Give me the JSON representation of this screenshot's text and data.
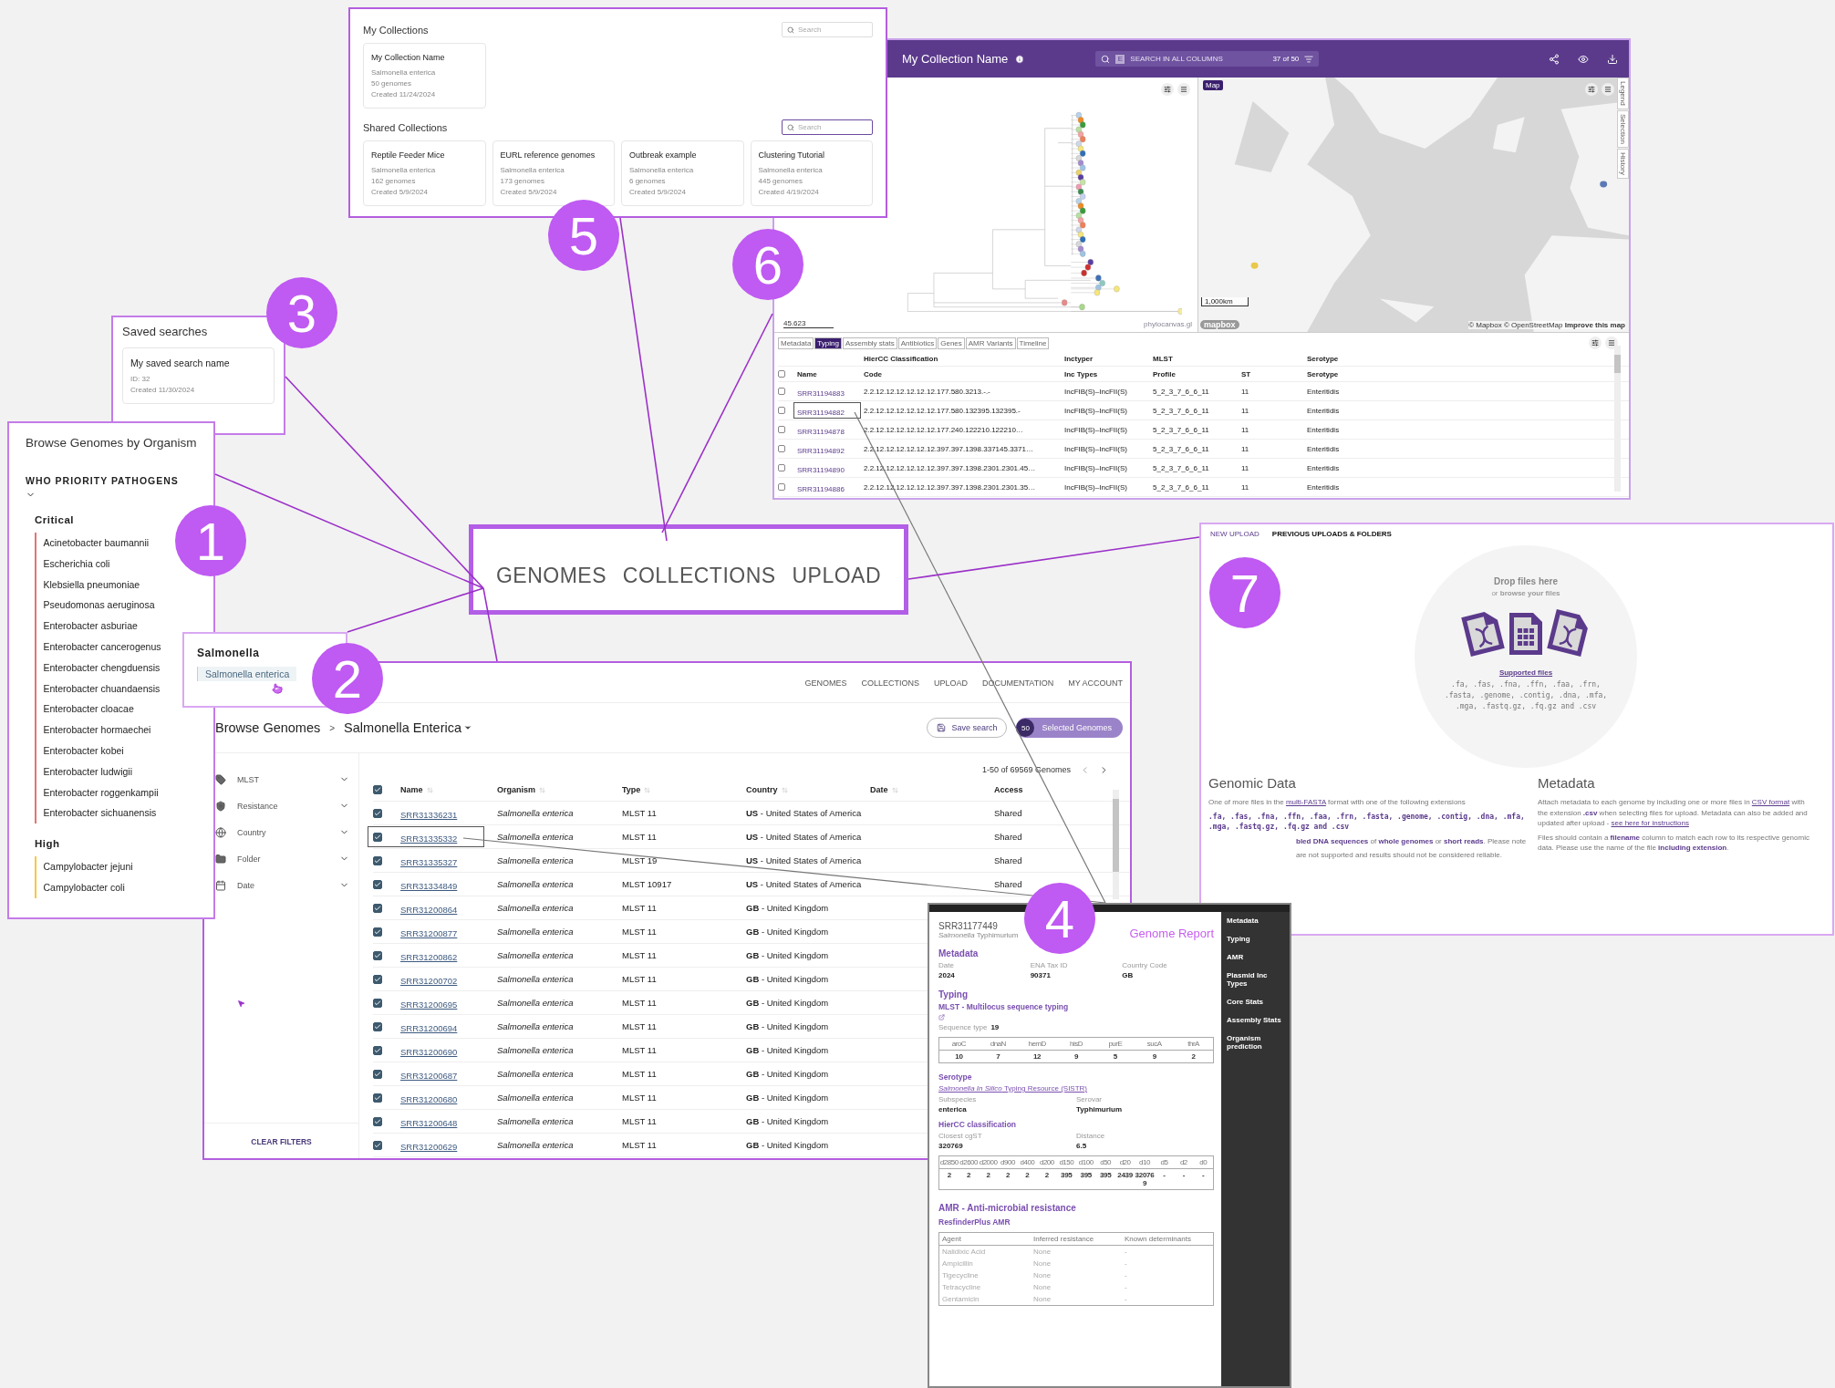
{
  "callouts": [
    "1",
    "2",
    "3",
    "4",
    "5",
    "6",
    "7"
  ],
  "saved_searches": {
    "title": "Saved searches",
    "items": [
      {
        "name": "My saved search name",
        "id": "ID: 32",
        "created": "Created 11/30/2024"
      }
    ]
  },
  "organism_browser": {
    "title": "Browse Genomes by Organism",
    "group": "WHO PRIORITY PATHOGENS",
    "expanded": true,
    "sections": [
      {
        "title": "Critical",
        "color": "#e57373",
        "items": [
          "Acinetobacter baumannii",
          "Escherichia coli",
          "Klebsiella pneumoniae",
          "Pseudomonas aeruginosa",
          "Enterobacter asburiae",
          "Enterobacter cancerogenus",
          "Enterobacter chengduensis",
          "Enterobacter chuandaensis",
          "Enterobacter cloacae",
          "Enterobacter hormaechei",
          "Enterobacter kobei",
          "Enterobacter ludwigii",
          "Enterobacter roggenkampii",
          "Enterobacter sichuanensis"
        ]
      },
      {
        "title": "High",
        "color": "#f5c842",
        "items": [
          "Campylobacter jejuni",
          "Campylobacter coli"
        ]
      }
    ]
  },
  "organism_popup": {
    "genus": "Salmonella",
    "species": "Salmonella enterica"
  },
  "nav_zoom": {
    "items": [
      "GENOMES",
      "COLLECTIONS",
      "UPLOAD"
    ]
  },
  "browse": {
    "nav": [
      "GENOMES",
      "COLLECTIONS",
      "UPLOAD",
      "DOCUMENTATION",
      "MY ACCOUNT"
    ],
    "breadcrumb": "Browse Genomes",
    "all_selected": true,
    "breadcrumb_separator": ">",
    "organism": "Salmonella Enterica",
    "save_button": "Save search",
    "selected_count": "50",
    "selected_label": "Selected Genomes",
    "filters": [
      "MLST",
      "Resistance",
      "Country",
      "Folder",
      "Date"
    ],
    "clear_filters": "CLEAR FILTERS",
    "pagination": "1-50 of 69569 Genomes",
    "columns": [
      {
        "label": "Name",
        "sortable": true
      },
      {
        "label": "Organism",
        "sortable": true
      },
      {
        "label": "Type",
        "sortable": true
      },
      {
        "label": "Country",
        "sortable": true
      },
      {
        "label": "Date",
        "sortable": true
      },
      {
        "label": "Access",
        "sortable": false
      }
    ],
    "rows": [
      {
        "checked": true,
        "highlighted": false,
        "name": "SRR31336231",
        "organism": "Salmonella enterica",
        "type": "MLST 11",
        "country": "**US** - United States of America",
        "access": "Shared"
      },
      {
        "checked": true,
        "highlighted": true,
        "name": "SRR31335332",
        "organism": "Salmonella enterica",
        "type": "MLST 11",
        "country": "**US** - United States of America",
        "access": "Shared"
      },
      {
        "checked": true,
        "highlighted": false,
        "name": "SRR31335327",
        "organism": "Salmonella enterica",
        "type": "MLST 19",
        "country": "**US** - United States of America",
        "access": "Shared"
      },
      {
        "checked": true,
        "highlighted": false,
        "name": "SRR31334849",
        "organism": "Salmonella enterica",
        "type": "MLST 10917",
        "country": "**US** - United States of America",
        "access": "Shared"
      },
      {
        "checked": true,
        "highlighted": false,
        "name": "SRR31200864",
        "organism": "Salmonella enterica",
        "type": "MLST 11",
        "country": "**GB** - United Kingdom"
      },
      {
        "checked": true,
        "highlighted": false,
        "name": "SRR31200877",
        "organism": "Salmonella enterica",
        "type": "MLST 11",
        "country": "**GB** - United Kingdom"
      },
      {
        "checked": true,
        "highlighted": false,
        "name": "SRR31200862",
        "organism": "Salmonella enterica",
        "type": "MLST 11",
        "country": "**GB** - United Kingdom"
      },
      {
        "checked": true,
        "highlighted": false,
        "name": "SRR31200702",
        "organism": "Salmonella enterica",
        "type": "MLST 11",
        "country": "**GB** - United Kingdom"
      },
      {
        "checked": true,
        "highlighted": false,
        "name": "SRR31200695",
        "organism": "Salmonella enterica",
        "type": "MLST 11",
        "country": "**GB** - United Kingdom"
      },
      {
        "checked": true,
        "highlighted": false,
        "name": "SRR31200694",
        "organism": "Salmonella enterica",
        "type": "MLST 11",
        "country": "**GB** - United Kingdom"
      },
      {
        "checked": true,
        "highlighted": false,
        "name": "SRR31200690",
        "organism": "Salmonella enterica",
        "type": "MLST 11",
        "country": "**GB** - United Kingdom"
      },
      {
        "checked": true,
        "highlighted": false,
        "name": "SRR31200687",
        "organism": "Salmonella enterica",
        "type": "MLST 11",
        "country": "**GB** - United Kingdom"
      },
      {
        "checked": true,
        "highlighted": false,
        "name": "SRR31200680",
        "organism": "Salmonella enterica",
        "type": "MLST 11",
        "country": "**GB** - United Kingdom"
      },
      {
        "checked": true,
        "highlighted": false,
        "name": "SRR31200648",
        "organism": "Salmonella enterica",
        "type": "MLST 11",
        "country": "**GB** - United Kingdom"
      },
      {
        "checked": true,
        "highlighted": false,
        "name": "SRR31200629",
        "organism": "Salmonella enterica",
        "type": "MLST 11",
        "country": "**GB** - United Kingdom"
      }
    ]
  },
  "collections": {
    "groups": [
      {
        "title": "My Collections",
        "search_placeholder": "Search",
        "focused": false,
        "cards": [
          {
            "name": "My Collection Name",
            "organism": "Salmonella enterica",
            "count": "50 genomes",
            "created": "Created 11/24/2024"
          }
        ]
      },
      {
        "title": "Shared Collections",
        "search_placeholder": "Search",
        "focused": true,
        "cards": [
          {
            "name": "Reptile Feeder Mice",
            "organism": "Salmonella enterica",
            "count": "162 genomes",
            "created": "Created 5/9/2024"
          },
          {
            "name": "EURL reference genomes",
            "organism": "Salmonella enterica",
            "count": "173 genomes",
            "created": "Created 5/9/2024"
          },
          {
            "name": "Outbreak example",
            "organism": "Salmonella enterica",
            "count": "6 genomes",
            "created": "Created 5/9/2024"
          },
          {
            "name": "Clustering Tutorial",
            "organism": "Salmonella enterica",
            "count": "445 genomes",
            "created": "Created 4/19/2024"
          }
        ]
      }
    ]
  },
  "viewer": {
    "title": "My Collection Name",
    "search_key": "E",
    "search_placeholder": "SEARCH IN ALL COLUMNS",
    "search_count": "37 of 50",
    "all_selected": false,
    "tree_scale": "45.623",
    "tree_brand": "phylocanvas.gl",
    "map_badge": "Map",
    "map_scale": "1,000km",
    "map_logo": "mapbox",
    "map_attribution": "© Mapbox © OpenStreetMap **Improve this map**",
    "side_tabs": [
      "Legend",
      "Selection",
      "History"
    ],
    "tabs": [
      {
        "label": "Metadata",
        "selected": false
      },
      {
        "label": "Typing",
        "selected": true
      },
      {
        "label": "Assembly stats",
        "selected": false
      },
      {
        "label": "Antibiotics",
        "selected": false
      },
      {
        "label": "Genes",
        "selected": false
      },
      {
        "label": "AMR Variants",
        "selected": false
      },
      {
        "label": "Timeline",
        "selected": false
      }
    ],
    "columns": [
      {
        "label": "Name"
      },
      {
        "label": "Code",
        "group": "HierCC Classification"
      },
      {
        "label": "Inc Types",
        "group": "Inctyper"
      },
      {
        "label": "Profile",
        "group": "MLST"
      },
      {
        "label": "ST"
      },
      {
        "label": "Serotype",
        "group": "Serotype"
      }
    ],
    "rows": [
      {
        "checked": false,
        "highlighted": false,
        "name": "SRR31194883",
        "code": "2.2.12.12.12.12.12.12.177.580.3213.-.-",
        "inc": "IncFIB(S)–IncFII(S)",
        "profile": "5_2_3_7_6_6_11",
        "st": "11",
        "serotype": "Enteritidis"
      },
      {
        "checked": false,
        "highlighted": true,
        "name": "SRR31194882",
        "code": "2.2.12.12.12.12.12.12.177.580.132395.132395.-",
        "inc": "IncFIB(S)–IncFII(S)",
        "profile": "5_2_3_7_6_6_11",
        "st": "11",
        "serotype": "Enteritidis"
      },
      {
        "checked": false,
        "highlighted": false,
        "name": "SRR31194878",
        "code": "2.2.12.12.12.12.12.12.177.240.122210.122210…",
        "inc": "IncFIB(S)–IncFII(S)",
        "profile": "5_2_3_7_6_6_11",
        "st": "11",
        "serotype": "Enteritidis"
      },
      {
        "checked": false,
        "highlighted": false,
        "name": "SRR31194892",
        "code": "2.2.12.12.12.12.12.12.397.397.1398.337145.3371…",
        "inc": "IncFIB(S)–IncFII(S)",
        "profile": "5_2_3_7_6_6_11",
        "st": "11",
        "serotype": "Enteritidis"
      },
      {
        "checked": false,
        "highlighted": false,
        "name": "SRR31194890",
        "code": "2.2.12.12.12.12.12.12.397.397.1398.2301.2301.45…",
        "inc": "IncFIB(S)–IncFII(S)",
        "profile": "5_2_3_7_6_6_11",
        "st": "11",
        "serotype": "Enteritidis"
      },
      {
        "checked": false,
        "highlighted": false,
        "name": "SRR31194886",
        "code": "2.2.12.12.12.12.12.12.397.397.1398.2301.2301.35…",
        "inc": "IncFIB(S)–IncFII(S)",
        "profile": "5_2_3_7_6_6_11",
        "st": "11",
        "serotype": "Enteritidis"
      }
    ]
  },
  "upload": {
    "tabs": [
      {
        "label": "NEW UPLOAD",
        "selected": true
      },
      {
        "label": "PREVIOUS UPLOADS & FOLDERS",
        "selected": false
      }
    ],
    "drop_title": "Drop files here",
    "drop_hint": "or **browse your files**",
    "supported_link": "Supported files",
    "supported_list": ".fa, .fas, .fna, .ffn, .faa, .frn, .fasta, .genome, .contig, .dna, .mfa, .mga, .fastq.gz, .fq.gz and .csv",
    "genomic": {
      "title": "Genomic Data",
      "intro_before": "One of more files in the",
      "intro_link": "multi-FASTA",
      "intro_after": "format with one of the following extensions",
      "extensions": ".fa, .fas, .fna, .ffn, .faa, .frn, .fasta, .genome, .contig, .dna, .mfa, .mga, .fastq.gz, .fq.gz and .csv",
      "note_lines": [
        "**bled DNA sequences** of **whole genomes** or **short reads**. Please note",
        "are not supported and results should not be considered reliable."
      ]
    },
    "metadata": {
      "title": "Metadata",
      "text_before": "Attach metadata to each genome by including one or more files in",
      "link": "CSV format",
      "text_after": "with the extension **.csv** when selecting files for upload. Metadata can also be added and updated after upload -",
      "link2": "see here for instructions",
      "text2": "Files should contain a **filename** column to match each row to its respective genomic data. Please use the name of the file **including extension**."
    }
  },
  "report": {
    "id": "SRR31177449",
    "organism": "*Salmonella* Typhimurium",
    "title": "Genome Report",
    "nav": [
      "Metadata",
      "Typing",
      "AMR",
      "Plasmid Inc Types",
      "Core Stats",
      "Assembly Stats",
      "Organism prediction"
    ],
    "metadata_title": "Metadata",
    "metadata": [
      {
        "label": "Date",
        "value": "2024"
      },
      {
        "label": "ENA Tax ID",
        "value": "90371"
      },
      {
        "label": "Country Code",
        "value": "GB"
      }
    ],
    "typing_title": "Typing",
    "mlst_title": "MLST - Multilocus sequence typing",
    "sequence_type_label": "Sequence type",
    "sequence_type": "19",
    "mlst_headers": [
      "aroC",
      "dnaN",
      "hemD",
      "hisD",
      "purE",
      "sucA",
      "thrA"
    ],
    "mlst_values": [
      "10",
      "7",
      "12",
      "9",
      "5",
      "9",
      "2"
    ],
    "serotype_title": "Serotype",
    "serotype_link": "*Salmonella In Silico* Typing Resource (SISTR)",
    "serotype_fields": [
      {
        "label": "Subspecies",
        "value": "enterica"
      },
      {
        "label": "Serovar",
        "value": "Typhimurium"
      }
    ],
    "hiercc_title": "HierCC classification",
    "hiercc_fields": [
      {
        "label": "Closest cgST",
        "value": "320769"
      },
      {
        "label": "Distance",
        "value": "6.5"
      }
    ],
    "hiercc_headers": [
      "d2850",
      "d2600",
      "d2000",
      "d900",
      "d400",
      "d200",
      "d150",
      "d100",
      "d50",
      "d20",
      "d10",
      "d5",
      "d2",
      "d0"
    ],
    "hiercc_values": [
      "2",
      "2",
      "2",
      "2",
      "2",
      "2",
      "395",
      "395",
      "395",
      "2439",
      "320769",
      "-",
      "-",
      "-"
    ],
    "amr_title": "AMR - Anti-microbial resistance",
    "amr_subtitle": "ResfinderPlus AMR",
    "amr_headers": [
      "Agent",
      "Inferred resistance",
      "Known determinants"
    ],
    "amr_rows": [
      [
        "Nalidixic Acid",
        "None",
        "-"
      ],
      [
        "Ampicillin",
        "None",
        "-"
      ],
      [
        "Tigecycline",
        "None",
        "-"
      ],
      [
        "Tetracycline",
        "None",
        "-"
      ],
      [
        "Gentamicin",
        "None",
        "-"
      ]
    ]
  }
}
